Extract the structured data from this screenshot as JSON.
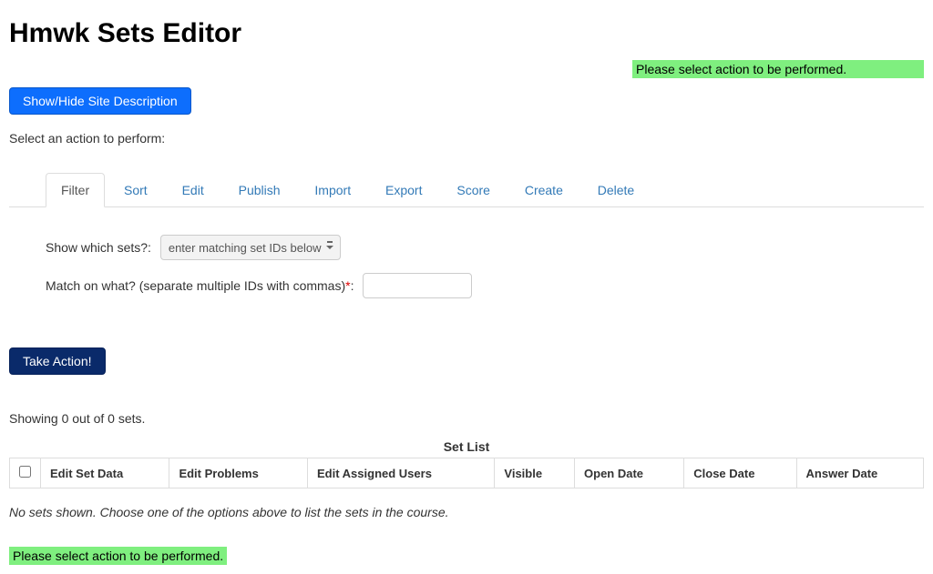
{
  "page": {
    "title": "Hmwk Sets Editor"
  },
  "alerts": {
    "top": "Please select action to be performed.",
    "bottom": "Please select action to be performed."
  },
  "buttons": {
    "toggleDescription": "Show/Hide Site Description",
    "takeAction": "Take Action!"
  },
  "instructions": {
    "selectAction": "Select an action to perform:"
  },
  "tabs": [
    {
      "label": "Filter",
      "active": true
    },
    {
      "label": "Sort"
    },
    {
      "label": "Edit"
    },
    {
      "label": "Publish"
    },
    {
      "label": "Import"
    },
    {
      "label": "Export"
    },
    {
      "label": "Score"
    },
    {
      "label": "Create"
    },
    {
      "label": "Delete"
    }
  ],
  "filterForm": {
    "whichSetsLabel": "Show which sets?:",
    "whichSetsSelected": "enter matching set IDs below",
    "matchLabel": "Match on what? (separate multiple IDs with commas)",
    "matchRequired": "*",
    "matchSuffix": ":",
    "matchValue": ""
  },
  "showing": "Showing 0 out of 0 sets.",
  "table": {
    "caption": "Set List",
    "columns": [
      "Edit Set Data",
      "Edit Problems",
      "Edit Assigned Users",
      "Visible",
      "Open Date",
      "Close Date",
      "Answer Date"
    ]
  },
  "emptyMessage": "No sets shown. Choose one of the options above to list the sets in the course."
}
